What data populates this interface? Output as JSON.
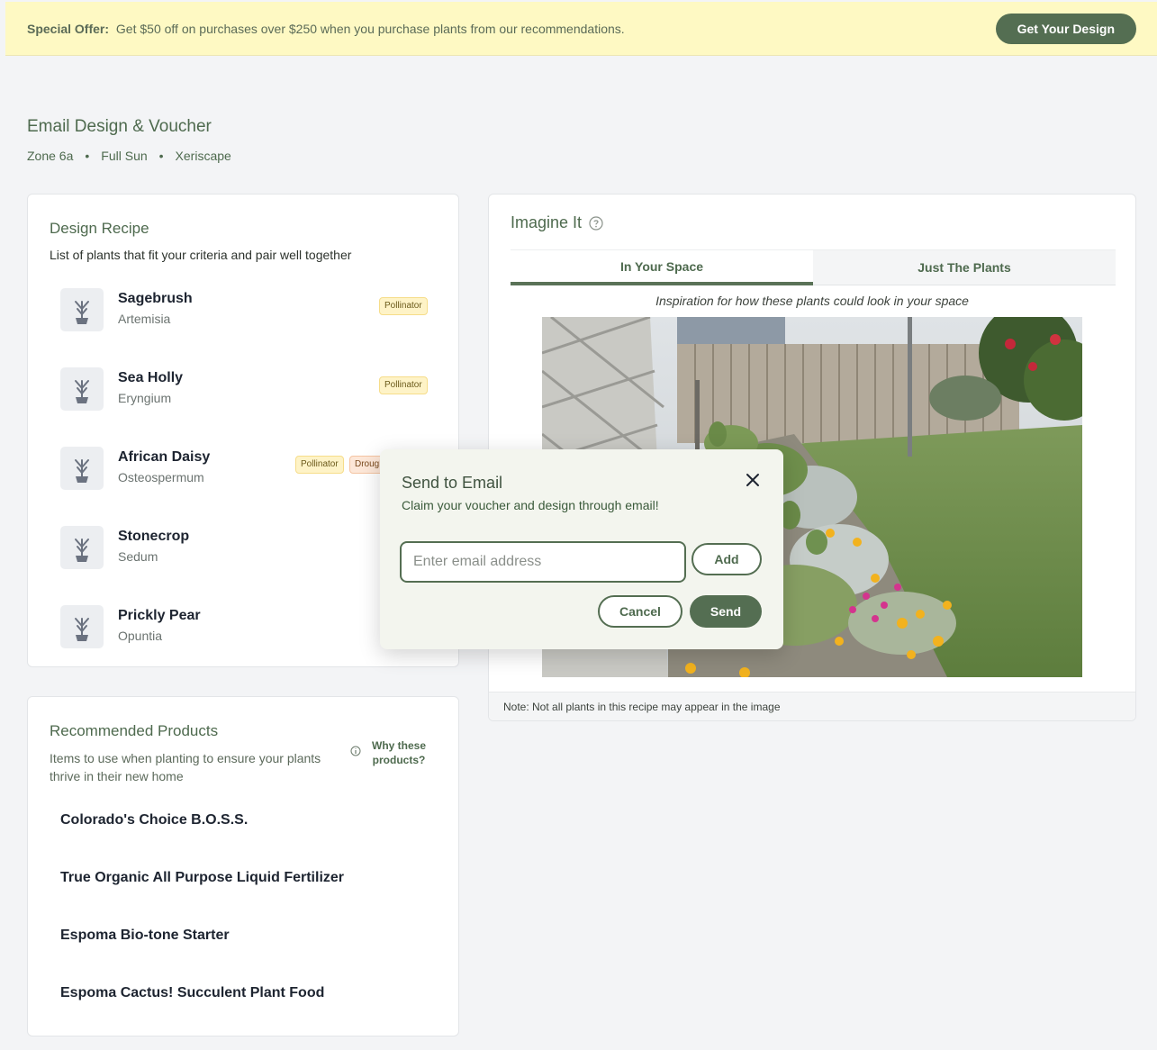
{
  "banner": {
    "offer_label": "Special Offer:",
    "offer_text": "Get $50 off on purchases over $250 when you purchase plants from our recommendations.",
    "cta_label": "Get Your Design"
  },
  "header": {
    "title": "Email Design & Voucher",
    "tags": [
      "Zone 6a",
      "Full Sun",
      "Xeriscape"
    ],
    "separator": "•"
  },
  "recipe": {
    "title": "Design Recipe",
    "subtitle": "List of plants that fit your criteria and pair well together",
    "plants": [
      {
        "name": "Sagebrush",
        "latin": "Artemisia",
        "badges": [
          "Pollinator"
        ]
      },
      {
        "name": "Sea Holly",
        "latin": "Eryngium",
        "badges": [
          "Pollinator"
        ]
      },
      {
        "name": "African Daisy",
        "latin": "Osteospermum",
        "badges": [
          "Pollinator",
          "Drough"
        ]
      },
      {
        "name": "Stonecrop",
        "latin": "Sedum",
        "badges": []
      },
      {
        "name": "Prickly Pear",
        "latin": "Opuntia",
        "badges": []
      }
    ]
  },
  "products": {
    "title": "Recommended Products",
    "subtitle": "Items to use when planting to ensure your plants thrive in their new home",
    "why_label": "Why these products?",
    "items": [
      "Colorado's Choice B.O.S.S.",
      "True Organic All Purpose Liquid Fertilizer",
      "Espoma Bio-tone Starter",
      "Espoma Cactus! Succulent Plant Food"
    ]
  },
  "imagine": {
    "title": "Imagine It",
    "tabs": [
      {
        "label": "In Your Space",
        "active": true
      },
      {
        "label": "Just The Plants",
        "active": false
      }
    ],
    "caption": "Inspiration for how these plants could look in your space",
    "note": "Note: Not all plants in this recipe may appear in the image"
  },
  "modal": {
    "title": "Send to Email",
    "subtitle": "Claim your voucher and design through email!",
    "email_placeholder": "Enter email address",
    "email_value": "",
    "add_label": "Add",
    "cancel_label": "Cancel",
    "send_label": "Send"
  },
  "colors": {
    "accent": "#546e52",
    "banner_bg": "#fef9c3",
    "badge_yellow": "#fef3c7",
    "badge_orange": "#fde7d8"
  },
  "icons": {
    "plant": "plant-sprout-icon",
    "help": "help-circle-icon",
    "info": "info-icon",
    "close": "close-icon"
  }
}
